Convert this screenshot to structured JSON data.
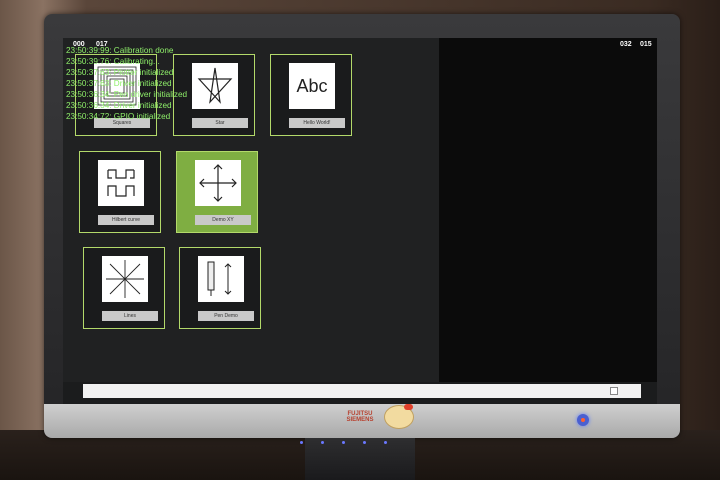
{
  "monitor": {
    "brand_line1": "FUJITSU",
    "brand_line2": "SIEMENS"
  },
  "counters": {
    "top_left_a": "000",
    "top_left_b": "017",
    "top_right_a": "032",
    "top_right_b": "015"
  },
  "tiles": [
    {
      "label": "Squares",
      "icon": "squares-icon"
    },
    {
      "label": "Star",
      "icon": "star-icon"
    },
    {
      "label": "Hello World!",
      "icon": "abc-icon",
      "image_text": "Abc"
    },
    {
      "label": "Hilbert curve",
      "icon": "hilbert-curve-icon"
    },
    {
      "label": "Demo XY",
      "icon": "move-arrows-icon",
      "selected": true
    },
    {
      "label": "Lines",
      "icon": "radial-lines-icon"
    },
    {
      "label": "Pen Demo",
      "icon": "pen-icon"
    }
  ],
  "log": [
    "23:50:39:99: Calibration done",
    "23:50:39:76: Calibrating...",
    "23:50:37:63: Plotter initialized",
    "23:50:37:63: Driver initialized",
    "23:50:36:34: Pen driver initialized",
    "23:50:36:34: Driver initialized",
    "23:50:34:72: GPIO initialized"
  ],
  "colors": {
    "tile_border": "#b3d96a",
    "tile_selected": "#7fae42",
    "log_text": "#8ff06a"
  }
}
